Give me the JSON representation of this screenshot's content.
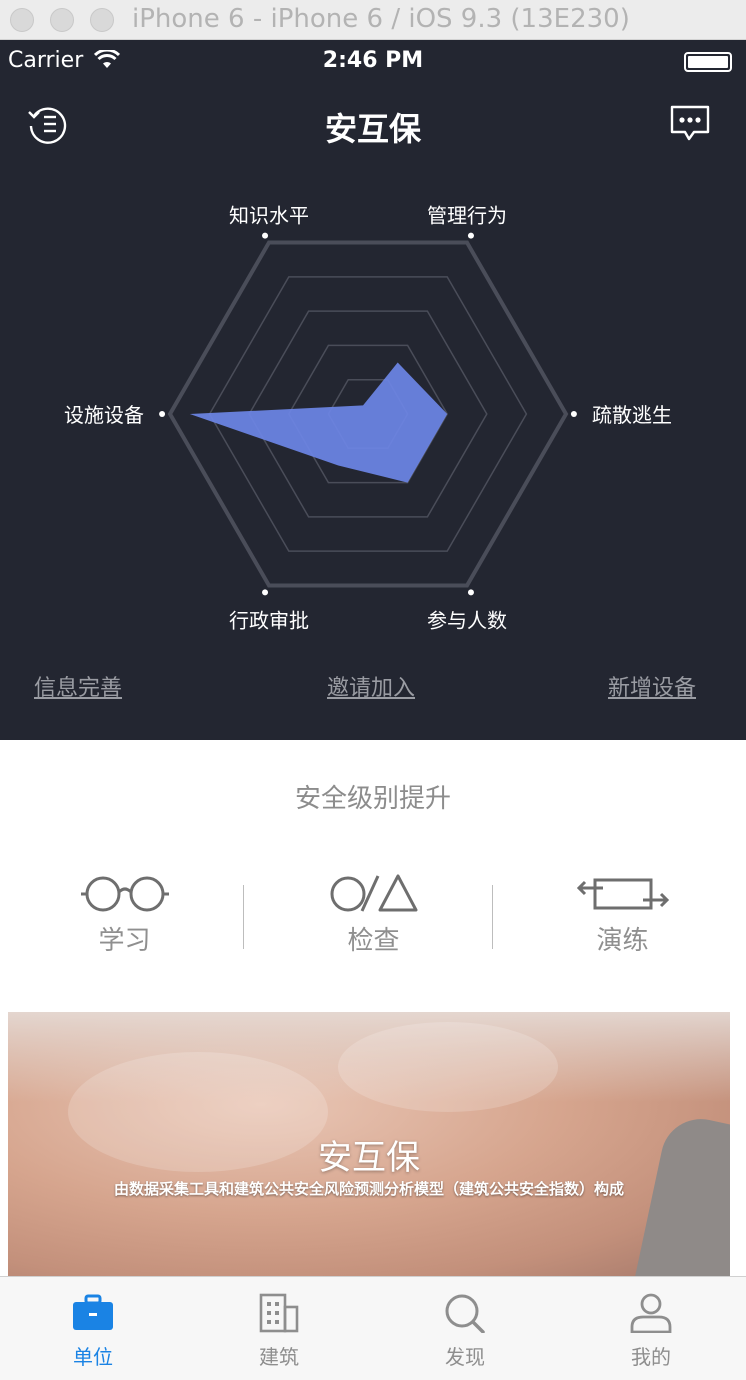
{
  "window": {
    "title": "iPhone 6 - iPhone 6 / iOS 9.3 (13E230)"
  },
  "status_bar": {
    "carrier": "Carrier",
    "time": "2:46 PM"
  },
  "nav": {
    "title": "安互保",
    "left_icon": "menu-circle-icon",
    "right_icon": "message-icon"
  },
  "radar": {
    "axes": [
      "管理行为",
      "疏散逃生",
      "参与人数",
      "行政审批",
      "设施设备",
      "知识水平"
    ],
    "values": [
      0.3,
      0.4,
      0.4,
      0.3,
      0.9,
      0.05
    ],
    "max": 1,
    "levels": 5,
    "fill_color": "#6d85e6",
    "grid_color": "#4a4d59"
  },
  "links": {
    "info": "信息完善",
    "invite": "邀请加入",
    "add_device": "新增设备"
  },
  "upgrade": {
    "title": "安全级别提升",
    "actions": [
      {
        "label": "学习",
        "icon": "glasses-icon"
      },
      {
        "label": "检查",
        "icon": "circle-triangle-icon"
      },
      {
        "label": "演练",
        "icon": "drill-arrows-icon"
      }
    ]
  },
  "banner": {
    "title": "安互保",
    "subtitle": "由数据采集工具和建筑公共安全风险预测分析模型（建筑公共安全指数）构成"
  },
  "tabbar": {
    "active_color": "#1a83e4",
    "items": [
      {
        "label": "单位",
        "icon": "briefcase-icon",
        "active": true
      },
      {
        "label": "建筑",
        "icon": "building-icon",
        "active": false
      },
      {
        "label": "发现",
        "icon": "search-icon",
        "active": false
      },
      {
        "label": "我的",
        "icon": "user-icon",
        "active": false
      }
    ]
  }
}
